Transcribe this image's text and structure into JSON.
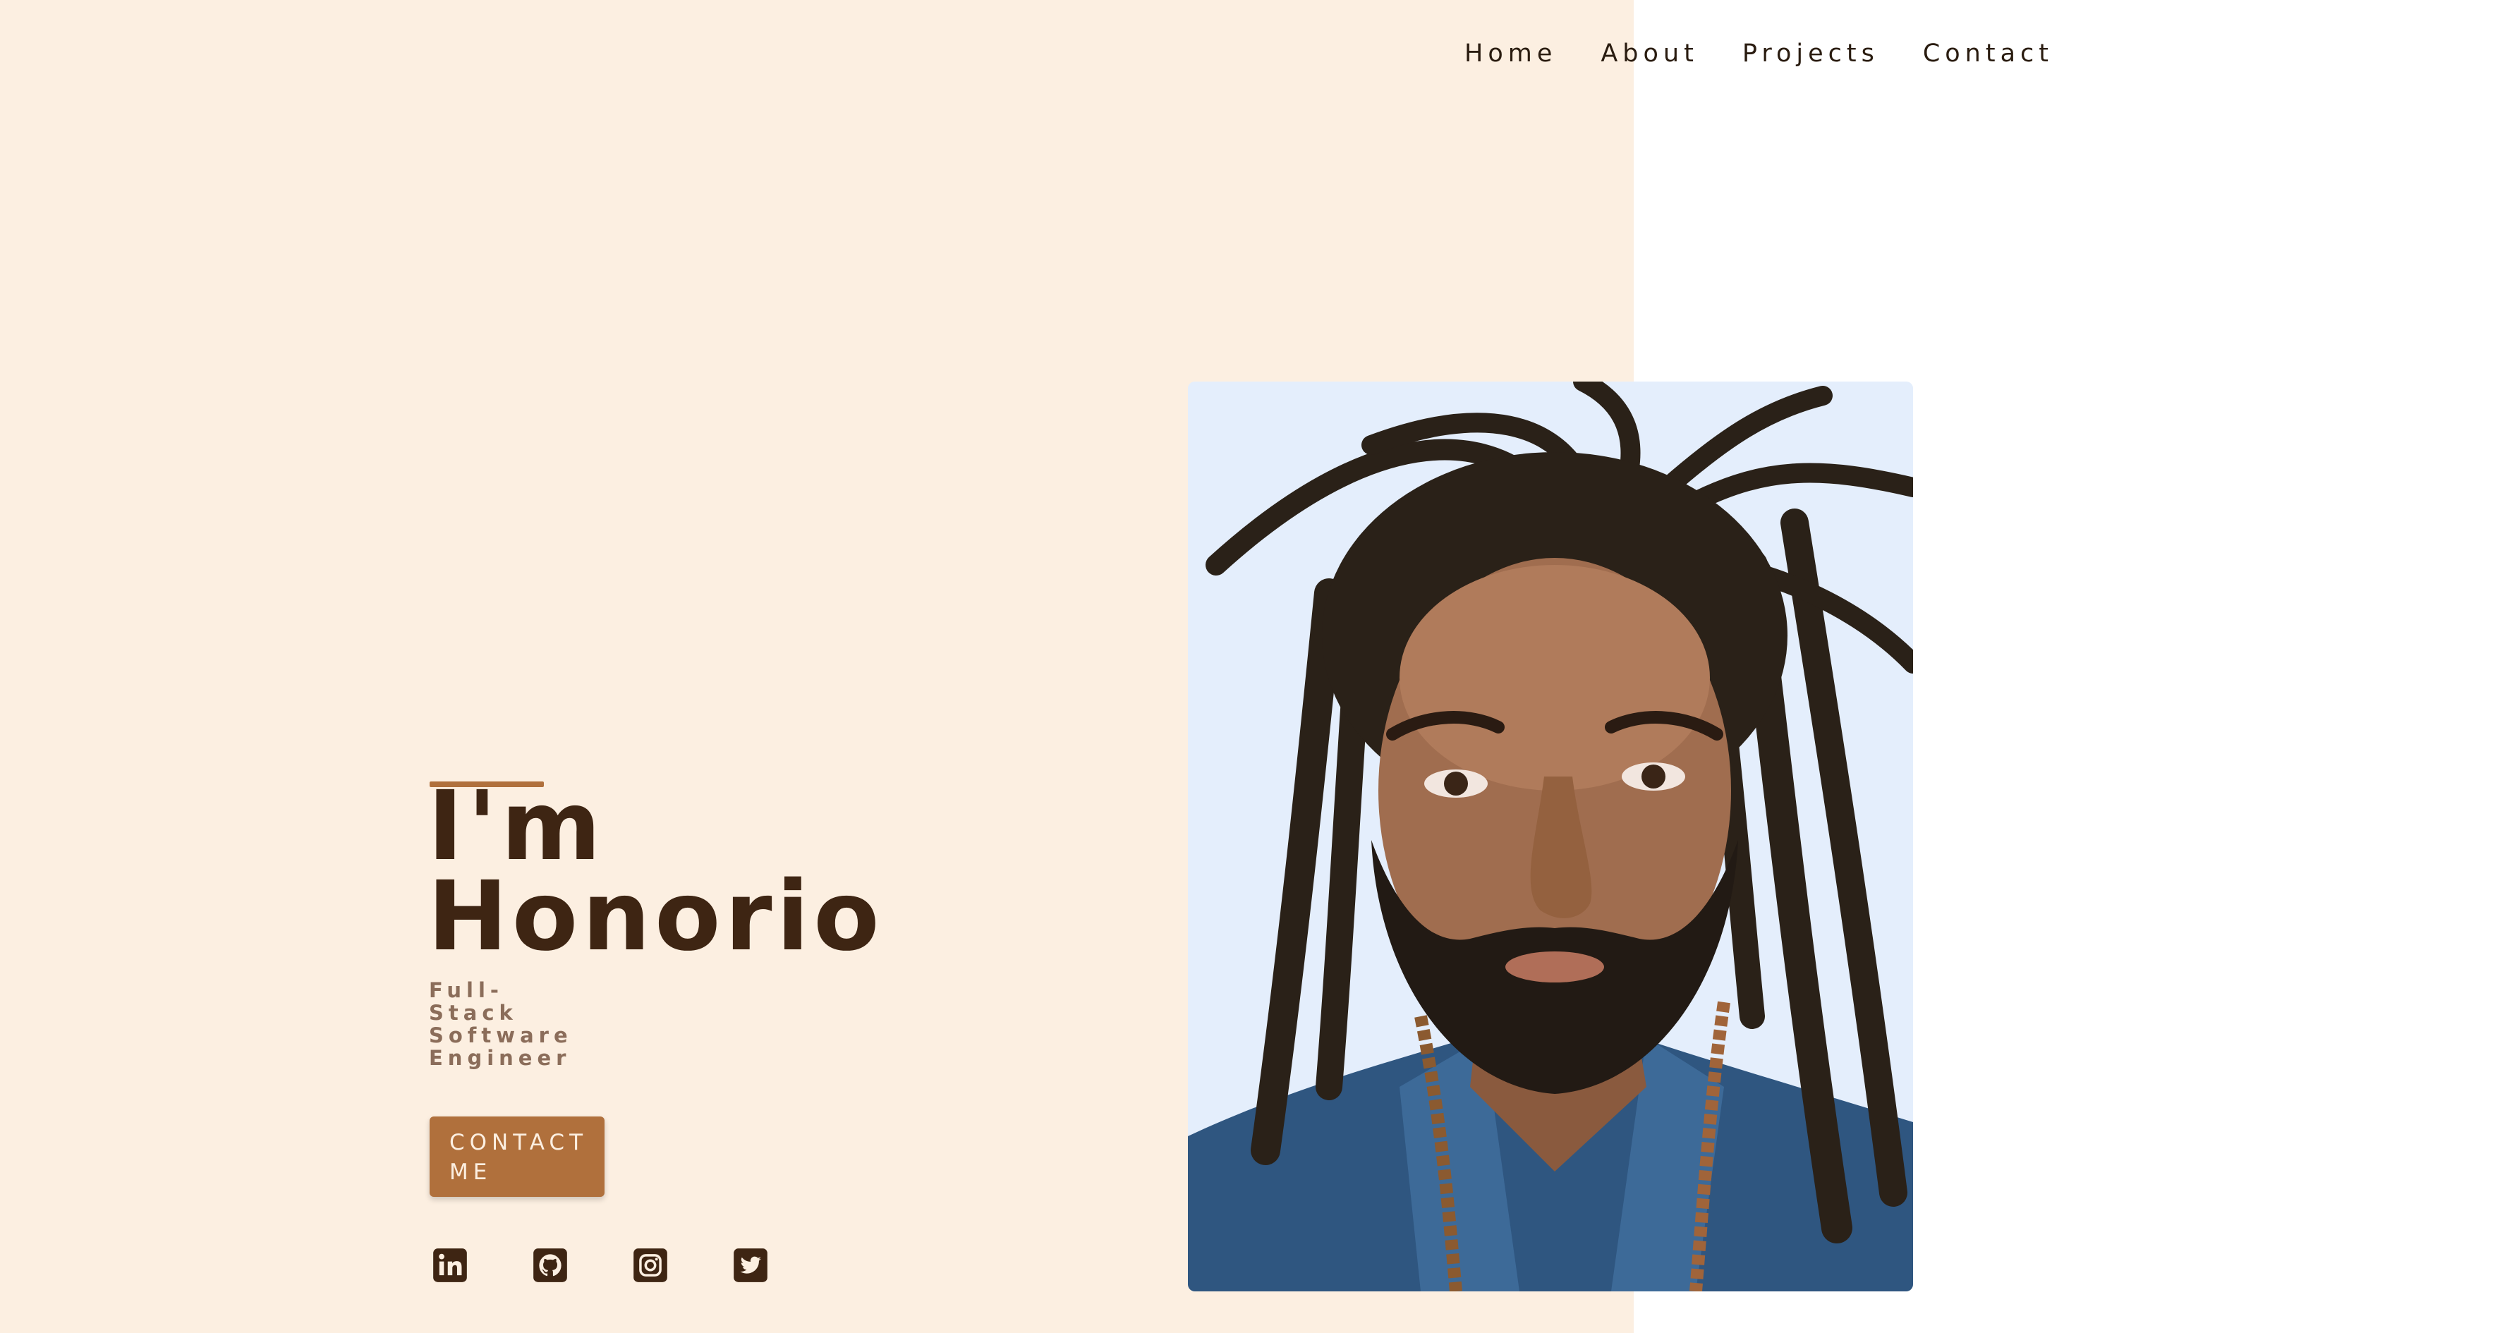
{
  "nav": {
    "items": [
      {
        "label": "Home"
      },
      {
        "label": "About"
      },
      {
        "label": "Projects"
      },
      {
        "label": "Contact"
      }
    ]
  },
  "hero": {
    "title_line1": "I'm",
    "title_line2": "Honorio",
    "subtitle_lines": [
      "Full-",
      "Stack",
      "Software",
      "Engineer"
    ],
    "button_lines": [
      "CONTACT",
      "ME"
    ]
  },
  "socials": [
    {
      "icon": "linkedin-icon"
    },
    {
      "icon": "github-icon"
    },
    {
      "icon": "instagram-icon"
    },
    {
      "icon": "twitter-icon"
    }
  ],
  "colors": {
    "left_bg": "#fcefe1",
    "accent": "#b0703c",
    "heading": "#3e2513",
    "subtitle": "#8b6d5a",
    "nav_text": "#2a1c10",
    "portrait_bg": "#e4eefc"
  }
}
